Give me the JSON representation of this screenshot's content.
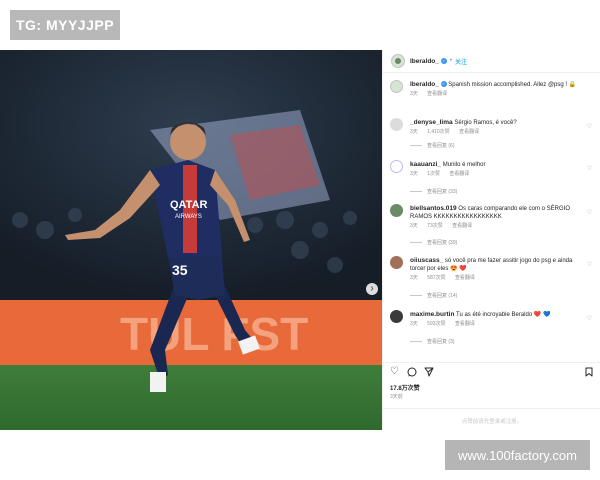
{
  "watermarks": {
    "top": "TG: MYYJJPP",
    "bottom": "www.100factory.com"
  },
  "post": {
    "player_number": "35",
    "sponsor_line1": "QATAR",
    "sponsor_line2": "AIRWAYS",
    "banner_text": "TUL FST",
    "next_icon": "chevron-right-icon"
  },
  "header": {
    "username": "lberaldo_",
    "dot": "•",
    "follow": "关注"
  },
  "caption": {
    "username": "lberaldo_",
    "text": "Spanish mission accomplished. Allez @psg ! 🔒",
    "time": "3天",
    "translate": "查看翻译"
  },
  "comments": [
    {
      "username": "_denyse_lima",
      "text": "Sérgio Ramos, é você?",
      "time": "3天",
      "likes": "1,410次赞",
      "translate": "查看翻译",
      "replies": "查看回复 (6)",
      "avatar_color": "#dcdcdc"
    },
    {
      "username": "kaauanzi_",
      "text": "Munilo é melhor",
      "time": "3天",
      "likes": "1次赞",
      "translate": "查看翻译",
      "replies": "查看回复 (33)",
      "avatar_color": "#c8b6e8"
    },
    {
      "username": "biellsantos.019",
      "text": "Os caras comparando ele com o SÉRGIO RAMOS KKKKKKKKKKKKKKKKK",
      "time": "3天",
      "likes": "73次赞",
      "translate": "查看翻译",
      "replies": "查看回复 (39)",
      "avatar_color": "#6b8a66"
    },
    {
      "username": "oiiuscass_",
      "text": "só você pra me fazer assitir jogo do psg e ainda torcer por eles 😍 ❤️",
      "time": "3天",
      "likes": "587次赞",
      "translate": "查看翻译",
      "replies": "查看回复 (14)",
      "avatar_color": "#a0705a"
    },
    {
      "username": "maxime.burtin",
      "text": "Tu as été incroyable Beraldo ❤️ 💙",
      "time": "3天",
      "likes": "593次赞",
      "translate": "查看翻译",
      "replies": "查看回复 (3)",
      "avatar_color": "#3a3a3a"
    }
  ],
  "actions": {
    "like": "heart-icon",
    "comment": "comment-icon",
    "share": "send-icon",
    "save": "bookmark-icon"
  },
  "stats": {
    "likes": "17.8万次赞",
    "date": "3天前"
  },
  "login_prompt": "点赞前请先登录或注册。"
}
